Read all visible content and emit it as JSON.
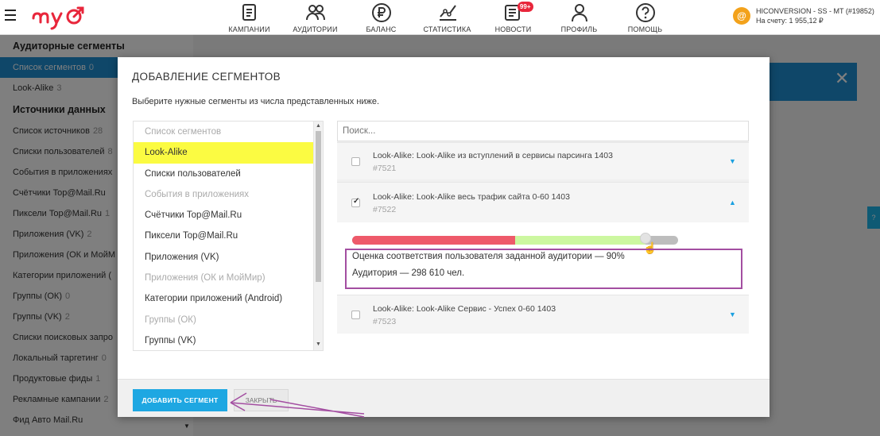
{
  "header": {
    "nav": [
      {
        "label": "КАМПАНИИ",
        "icon": "campaigns-icon"
      },
      {
        "label": "АУДИТОРИИ",
        "icon": "audiences-icon"
      },
      {
        "label": "БАЛАНС",
        "icon": "ruble-icon"
      },
      {
        "label": "СТАТИСТИКА",
        "icon": "statistics-icon"
      },
      {
        "label": "НОВОСТИ",
        "icon": "news-icon",
        "badge": "99+"
      },
      {
        "label": "ПРОФИЛЬ",
        "icon": "profile-icon"
      },
      {
        "label": "ПОМОЩЬ",
        "icon": "help-icon"
      }
    ],
    "account": {
      "avatar": "@",
      "name": "HICONVERSION - SS - MT (#19852)",
      "balance": "На счету: 1 955,12 ₽"
    }
  },
  "sidebar": {
    "section1": "Аудиторные сегменты",
    "items1": [
      {
        "label": "Список сегментов",
        "count": "0"
      },
      {
        "label": "Look-Alike",
        "count": "3"
      }
    ],
    "section2": "Источники данных",
    "items2": [
      {
        "label": "Список источников",
        "count": "28"
      },
      {
        "label": "Списки пользователей",
        "count": "8"
      },
      {
        "label": "События в приложениях",
        "count": ""
      },
      {
        "label": "Счётчики Top@Mail.Ru",
        "count": ""
      },
      {
        "label": "Пиксели Top@Mail.Ru",
        "count": "1"
      },
      {
        "label": "Приложения (VK)",
        "count": "2"
      },
      {
        "label": "Приложения (ОК и МойМ",
        "count": ""
      },
      {
        "label": "Категории приложений (",
        "count": ""
      },
      {
        "label": "Группы (ОК)",
        "count": "0"
      },
      {
        "label": "Группы (VK)",
        "count": "2"
      },
      {
        "label": "Списки поисковых запро",
        "count": ""
      },
      {
        "label": "Локальный таргетинг",
        "count": "0"
      },
      {
        "label": "Продуктовые фиды",
        "count": "1"
      },
      {
        "label": "Рекламные кампании",
        "count": "2"
      },
      {
        "label": "Фид Авто Mail.Ru",
        "count": ""
      }
    ]
  },
  "modal": {
    "title": "ДОБАВЛЕНИЕ СЕГМЕНТОВ",
    "subtitle": "Выберите нужные сегменты из числа представленных ниже.",
    "categories": [
      {
        "label": "Список сегментов",
        "disabled": true
      },
      {
        "label": "Look-Alike",
        "selected": true
      },
      {
        "label": "Списки пользователей"
      },
      {
        "label": "События в приложениях",
        "disabled": true
      },
      {
        "label": "Счётчики Top@Mail.Ru"
      },
      {
        "label": "Пиксели Top@Mail.Ru"
      },
      {
        "label": "Приложения (VK)"
      },
      {
        "label": "Приложения (ОК и МойМир)",
        "disabled": true
      },
      {
        "label": "Категории приложений (Android)"
      },
      {
        "label": "Группы (ОК)",
        "disabled": true
      },
      {
        "label": "Группы (VK)"
      }
    ],
    "search_placeholder": "Поиск...",
    "segments": [
      {
        "title": "Look-Alike: Look-Alike из вступлений в сервисы парсинга 1403",
        "id": "#7521",
        "checked": false
      },
      {
        "title": "Look-Alike: Look-Alike весь трафик сайта 0-60 1403",
        "id": "#7522",
        "checked": true
      },
      {
        "title": "Look-Alike: Look-Alike Сервис - Успех 0-60 1403",
        "id": "#7523",
        "checked": false
      }
    ],
    "match": {
      "red_fraction": 0.5,
      "level_fraction": 0.9,
      "estimate": "Оценка соответствия пользователя заданной аудитории — 90%",
      "audience": "Аудитория — 298 610 чел."
    },
    "add_button": "ДОБАВИТЬ СЕГМЕНТ",
    "close_button": "ЗАКРЫТЬ"
  },
  "colors": {
    "accent": "#1ea7e2",
    "highlight": "#fbfb42",
    "annotation": "#a34ea1",
    "bar_red": "#ee5a6a",
    "bar_green": "#ccf7a0"
  }
}
